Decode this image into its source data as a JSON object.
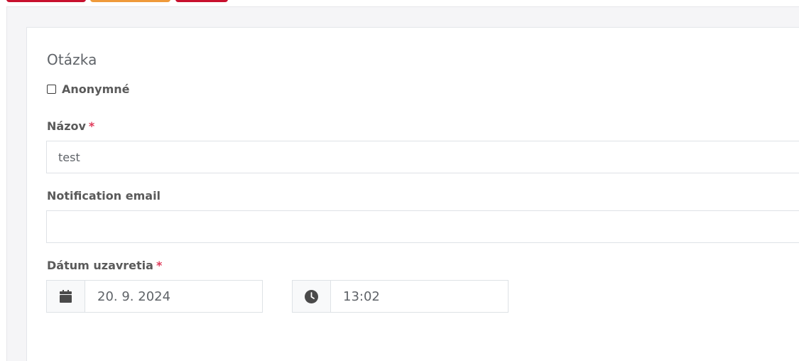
{
  "toolbar": {
    "buttons": [
      {
        "name": "toolbar-button-red",
        "color": "#c8102e"
      },
      {
        "name": "toolbar-button-orange",
        "color": "#ef9a3a"
      },
      {
        "name": "toolbar-button-red-2",
        "color": "#c8102e"
      }
    ]
  },
  "form": {
    "title": "Otázka",
    "anonymous": {
      "label": "Anonymné",
      "checked": false
    },
    "name": {
      "label": "Názov",
      "required_mark": "*",
      "value": "test"
    },
    "notification_email": {
      "label": "Notification email",
      "value": ""
    },
    "close_date": {
      "label": "Dátum uzavretia",
      "required_mark": "*",
      "date": {
        "value": "20. 9. 2024",
        "icon": "calendar-icon"
      },
      "time": {
        "value": "13:02",
        "icon": "clock-icon"
      }
    }
  },
  "colors": {
    "accent_required": "#e03a5a",
    "page_background": "#f5f5f7",
    "card_background": "#ffffff"
  }
}
